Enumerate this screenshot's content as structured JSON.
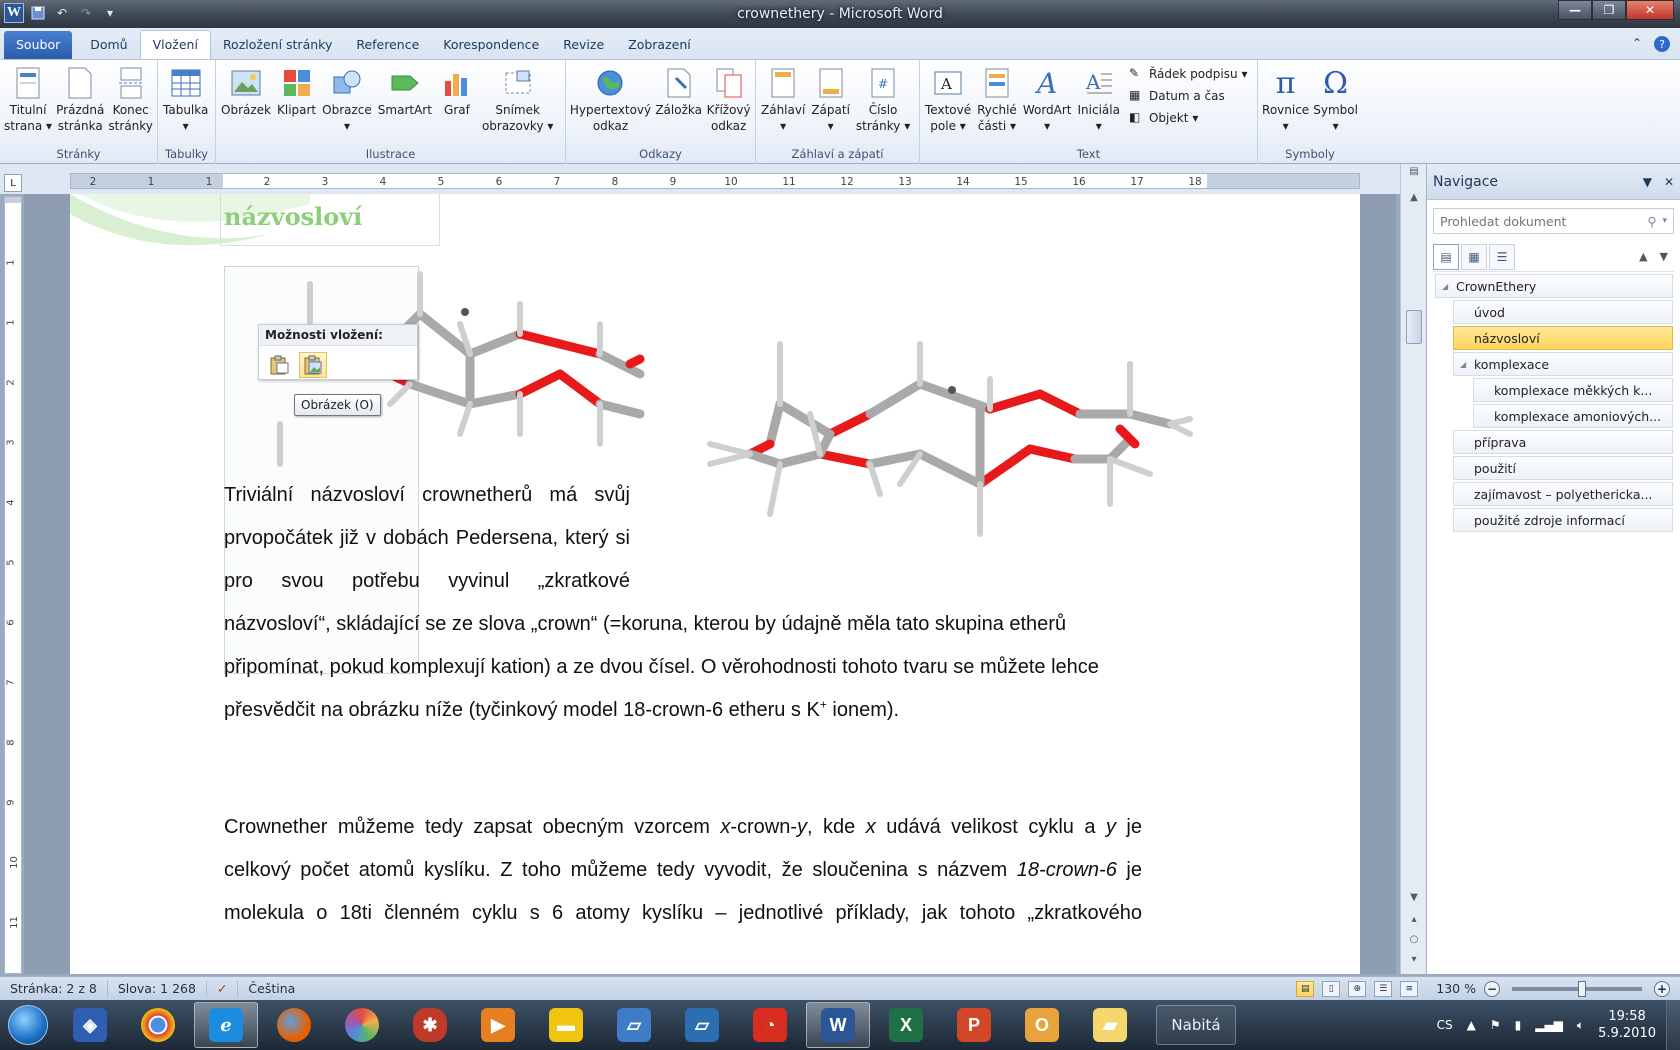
{
  "window": {
    "title": "crownethery - Microsoft Word"
  },
  "tabs": [
    {
      "label": "Soubor",
      "kind": "file"
    },
    {
      "label": "Domů"
    },
    {
      "label": "Vložení",
      "active": true
    },
    {
      "label": "Rozložení stránky"
    },
    {
      "label": "Reference"
    },
    {
      "label": "Korespondence"
    },
    {
      "label": "Revize"
    },
    {
      "label": "Zobrazení"
    }
  ],
  "ribbon": {
    "pages": {
      "name": "Stránky",
      "title_page": [
        "Titulní",
        "strana"
      ],
      "blank_page": [
        "Prázdná",
        "stránka"
      ],
      "page_break": [
        "Konec",
        "stránky"
      ]
    },
    "tables": {
      "name": "Tabulky",
      "table": "Tabulka"
    },
    "illustrations": {
      "name": "Ilustrace",
      "picture": "Obrázek",
      "clipart": "Klipart",
      "shapes": "Obrazce",
      "smartart": "SmartArt",
      "chart": "Graf",
      "screenshot": [
        "Snímek",
        "obrazovky"
      ]
    },
    "links": {
      "name": "Odkazy",
      "hyperlink": [
        "Hypertextový",
        "odkaz"
      ],
      "bookmark": "Záložka",
      "crossref": [
        "Křížový",
        "odkaz"
      ]
    },
    "header_footer": {
      "name": "Záhlaví a zápatí",
      "header": "Záhlaví",
      "footer": "Zápatí",
      "page_number": [
        "Číslo",
        "stránky"
      ]
    },
    "text": {
      "name": "Text",
      "textbox": [
        "Textové",
        "pole"
      ],
      "quickparts": [
        "Rychlé",
        "části"
      ],
      "wordart": "WordArt",
      "dropcap": "Iniciála",
      "signature": "Řádek podpisu",
      "datetime": "Datum a čas",
      "object": "Objekt"
    },
    "symbols": {
      "name": "Symboly",
      "equation": "Rovnice",
      "symbol": "Symbol"
    }
  },
  "ruler": {
    "ticks": [
      "2",
      "1",
      "1",
      "2",
      "3",
      "4",
      "5",
      "6",
      "7",
      "8",
      "9",
      "10",
      "11",
      "12",
      "13",
      "14",
      "15",
      "16",
      "17",
      "18"
    ]
  },
  "vruler": {
    "ticks": [
      "1",
      "1",
      "2",
      "3",
      "4",
      "5",
      "6",
      "7",
      "8",
      "9",
      "10",
      "11",
      "12"
    ]
  },
  "document": {
    "heading": "názvosloví",
    "paste_options_title": "Možnosti vložení:",
    "tooltip": "Obrázek (O)",
    "para1": [
      "Triviální názvosloví crownetherů má svůj",
      "prvopočátek již v dobách Pedersena, který si",
      "pro svou potřebu vyvinul „zkratkové",
      "názvosloví“, skládající se ze slova „crown“ (=koruna, kterou by údajně měla tato skupina etherů",
      "připomínat, pokud komplexují kation) a ze dvou čísel. O věrohodnosti tohoto tvaru se můžete lehce"
    ],
    "para1_last_before": "přesvědčit na obrázku níže (tyčinkový model 18-crown-6 etheru s K",
    "para1_last_sup": "+",
    "para1_last_after": " ionem).",
    "para2": {
      "l1_a": "Crownether můžeme tedy zapsat obecným vzorcem ",
      "l1_x": "x",
      "l1_b": "-crown-",
      "l1_y": "y",
      "l1_c": ", kde ",
      "l1_x2": "x",
      "l1_d": " udává velikost cyklu a ",
      "l1_y2": "y",
      "l1_e": " je",
      "l2_a": "celkový počet atomů kyslíku. Z toho můžeme tedy vyvodit, že sloučenina s názvem ",
      "l2_i": "18-crown-6",
      "l2_b": " je",
      "l3": "molekula o 18ti členném cyklu s 6 atomy kyslíku – jednotlivé příklady, jak tohoto „zkratkového"
    }
  },
  "nav": {
    "title": "Navigace",
    "search_placeholder": "Prohledat dokument",
    "items": [
      {
        "label": "CrownEthery",
        "level": 0,
        "expanded": true
      },
      {
        "label": "úvod",
        "level": 1
      },
      {
        "label": "názvosloví",
        "level": 1,
        "selected": true
      },
      {
        "label": "komplexace",
        "level": 1,
        "expanded": true
      },
      {
        "label": "komplexace měkkých k...",
        "level": 2
      },
      {
        "label": "komplexace amoniových...",
        "level": 2
      },
      {
        "label": "příprava",
        "level": 1
      },
      {
        "label": "použití",
        "level": 1
      },
      {
        "label": "zajímavost – polyethericka...",
        "level": 1
      },
      {
        "label": "použité zdroje informací",
        "level": 1
      }
    ]
  },
  "status": {
    "page": "Stránka: 2 z 8",
    "words": "Slova: 1 268",
    "language": "Čeština",
    "zoom": "130 %",
    "zoom_percent": 130
  },
  "taskbar": {
    "nabita": "Nabitá",
    "lang": "CS",
    "time": "19:58",
    "date": "5.9.2010"
  },
  "colors": {
    "heading_green": "#8ccf7a",
    "oxygen_red": "#e8191b",
    "carbon_gray": "#a9a9a9",
    "nav_selected": "#ffd45a"
  }
}
